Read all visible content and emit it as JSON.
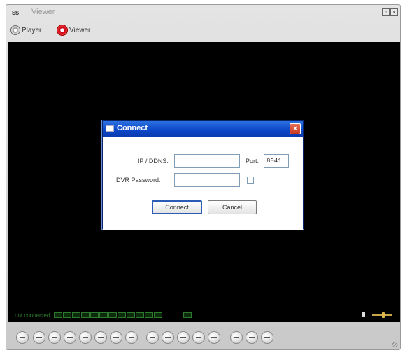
{
  "window": {
    "logo": "SS",
    "title": "Viewer",
    "minimize_glyph": "▫",
    "close_glyph": "×"
  },
  "tabs": [
    {
      "label": "Player",
      "icon": "player-icon"
    },
    {
      "label": "Viewer",
      "icon": "viewer-icon"
    }
  ],
  "status": {
    "text": "not connected",
    "channel_count": 12,
    "color": "#2d7a2d"
  },
  "volume": {
    "level": 0.6
  },
  "controls": {
    "button_count": 16
  },
  "dialog": {
    "title": "Connect",
    "ip_label": "IP / DDNS:",
    "ip_value": "",
    "port_label": "Port:",
    "port_value": "8041",
    "password_label": "DVR Password:",
    "password_value": "",
    "connect_label": "Connect",
    "cancel_label": "Cancel",
    "close_glyph": "×"
  }
}
